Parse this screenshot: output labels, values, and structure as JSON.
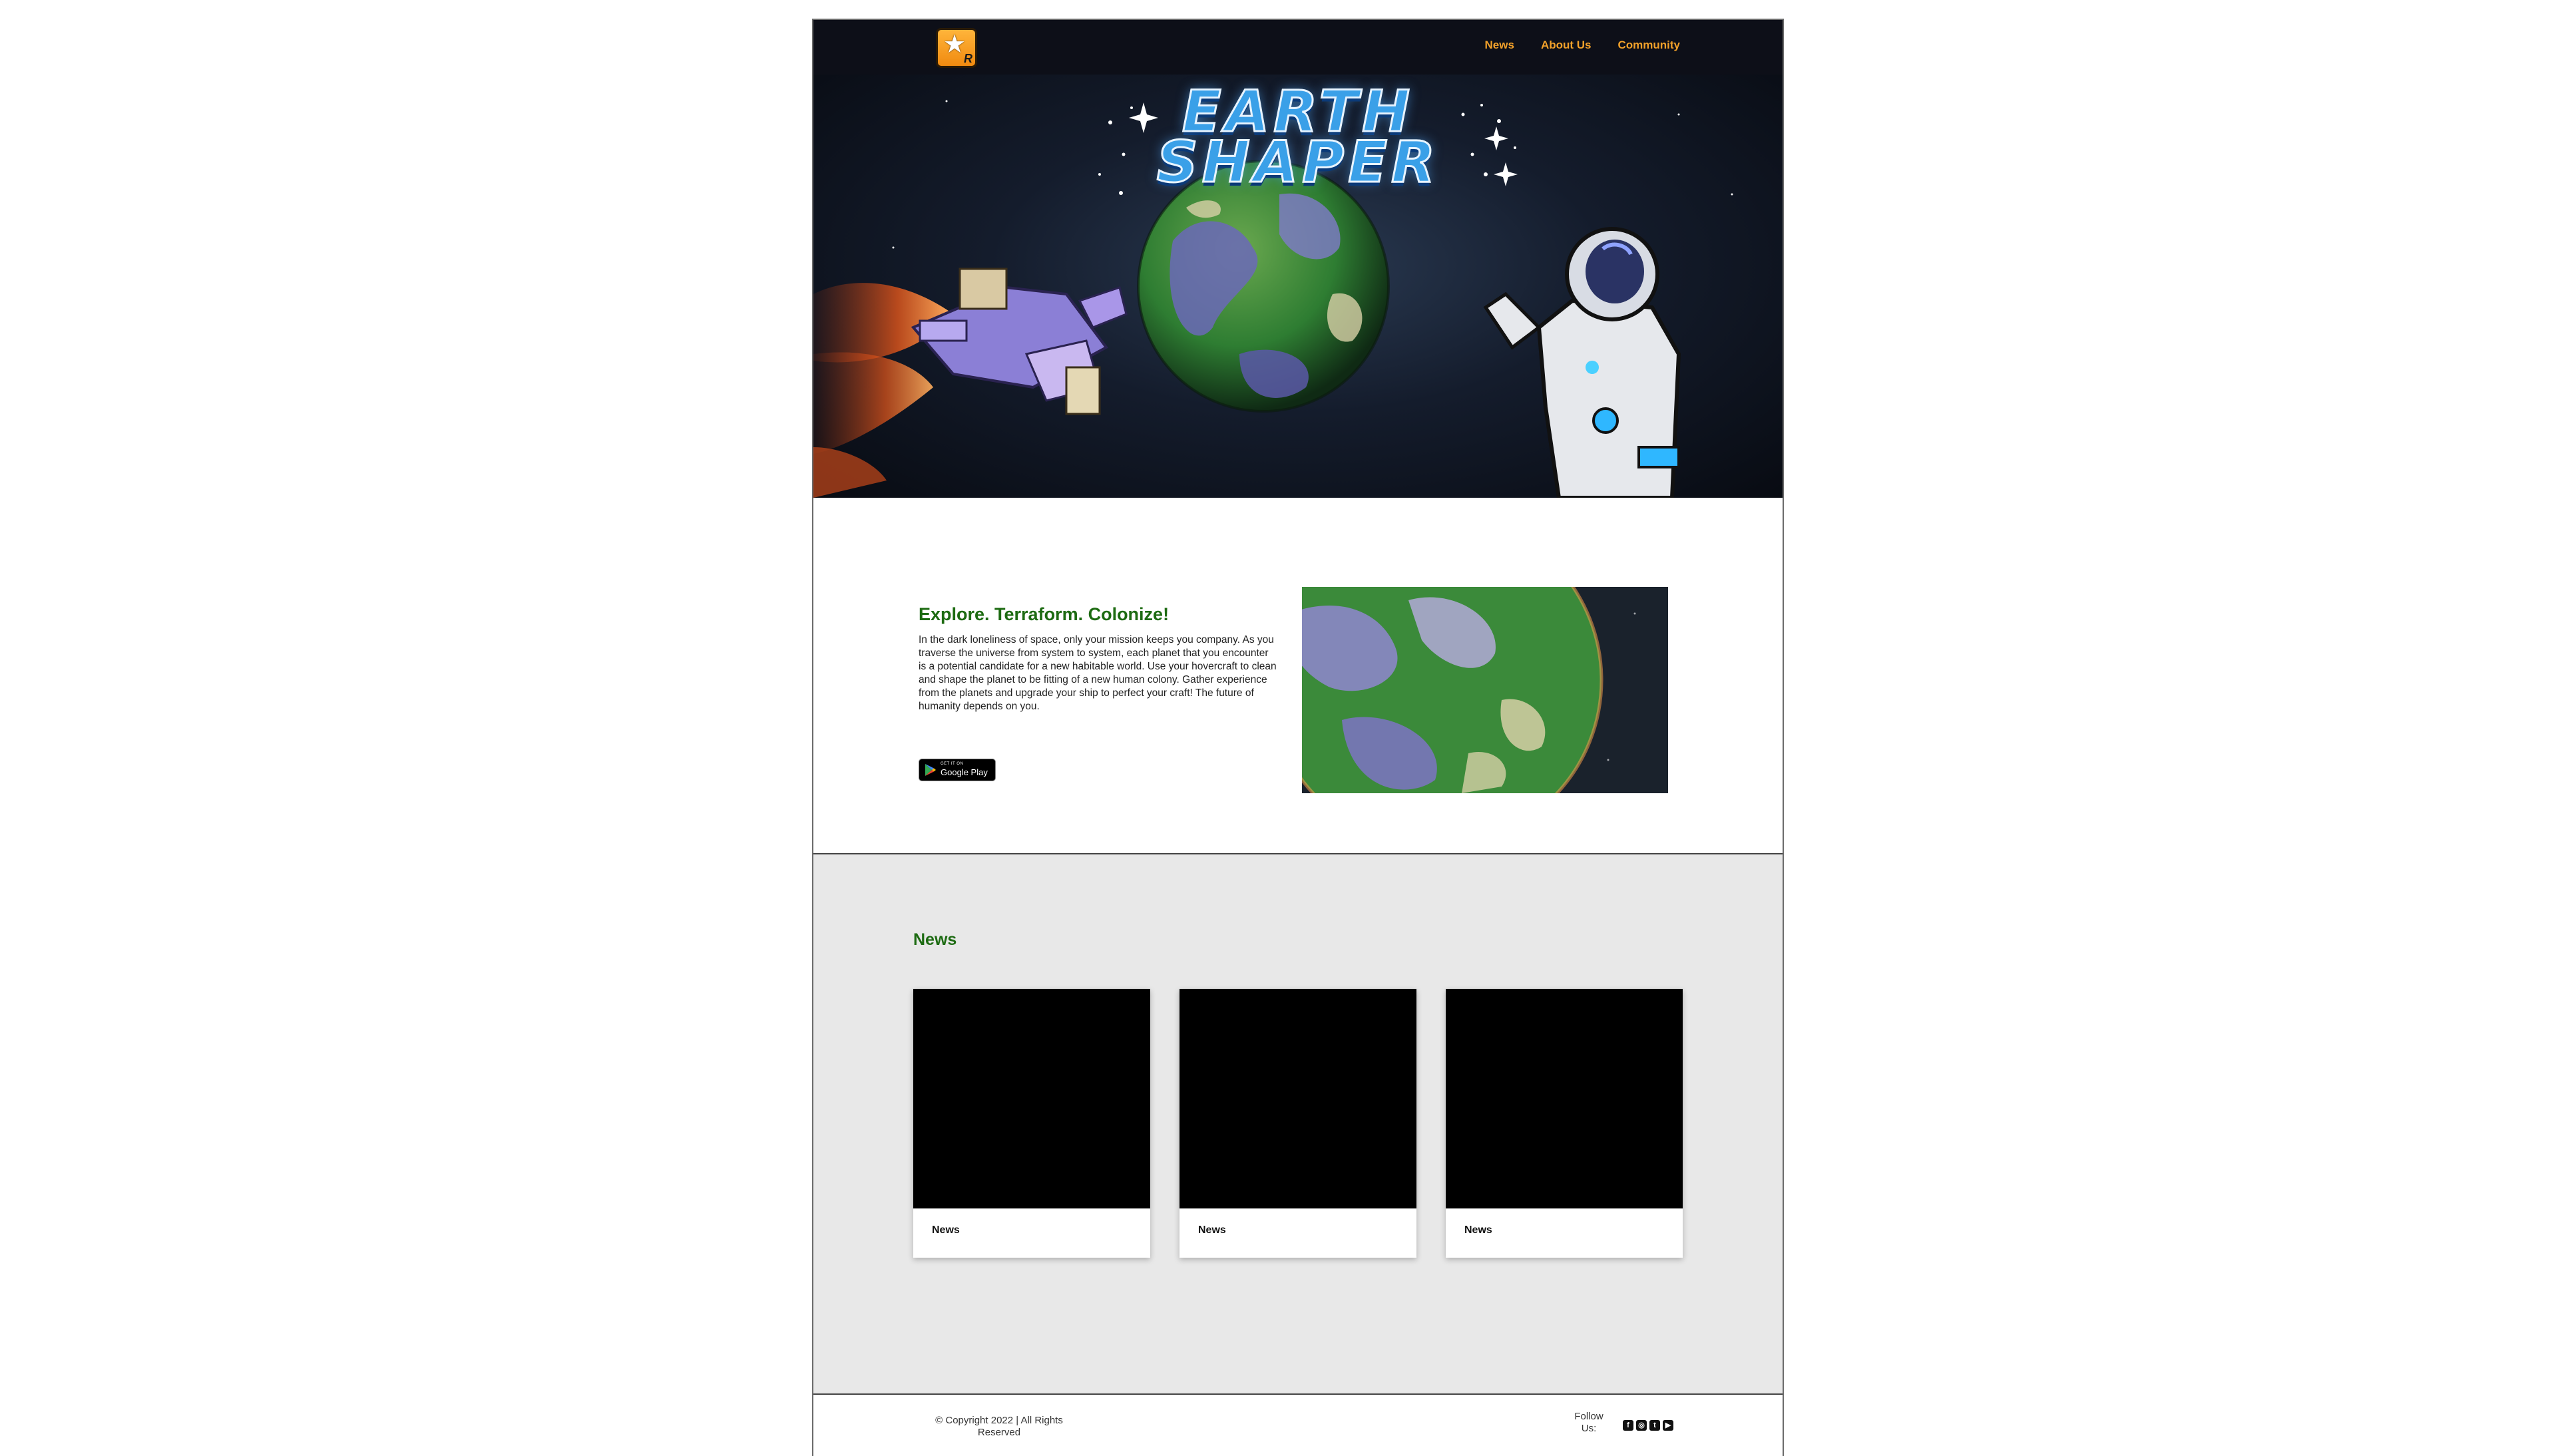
{
  "nav": {
    "logo_letter": "R",
    "links": [
      {
        "label": "News"
      },
      {
        "label": "About Us"
      },
      {
        "label": "Community"
      }
    ]
  },
  "hero": {
    "title_line1": "EARTH",
    "title_line2": "SHAPER"
  },
  "about": {
    "heading": "Explore. Terraform. Colonize!",
    "body": "In the dark loneliness of space, only your mission keeps you company. As you traverse the universe from system to system, each planet that you encounter is a potential candidate for a new habitable world. Use your hovercraft to clean and shape the planet to be fitting of a new human colony. Gather experience from the planets and upgrade your ship to perfect your craft! The future of humanity depends on you.",
    "store_badge": {
      "small": "GET IT ON",
      "big": "Google Play"
    }
  },
  "news": {
    "heading": "News",
    "cards": [
      {
        "label": "News"
      },
      {
        "label": "News"
      },
      {
        "label": "News"
      }
    ]
  },
  "footer": {
    "copyright": "© Copyright 2022 | All Rights Reserved",
    "follow": "Follow Us:",
    "socials": [
      {
        "icon": "facebook-icon",
        "glyph": "f"
      },
      {
        "icon": "instagram-icon",
        "glyph": "◎"
      },
      {
        "icon": "twitter-icon",
        "glyph": "t"
      },
      {
        "icon": "youtube-icon",
        "glyph": "▶"
      }
    ]
  },
  "colors": {
    "nav_bg": "#0d0f18",
    "nav_link": "#f2a12a",
    "heading_green": "#1d6b12",
    "news_bg": "#e8e8e8"
  }
}
